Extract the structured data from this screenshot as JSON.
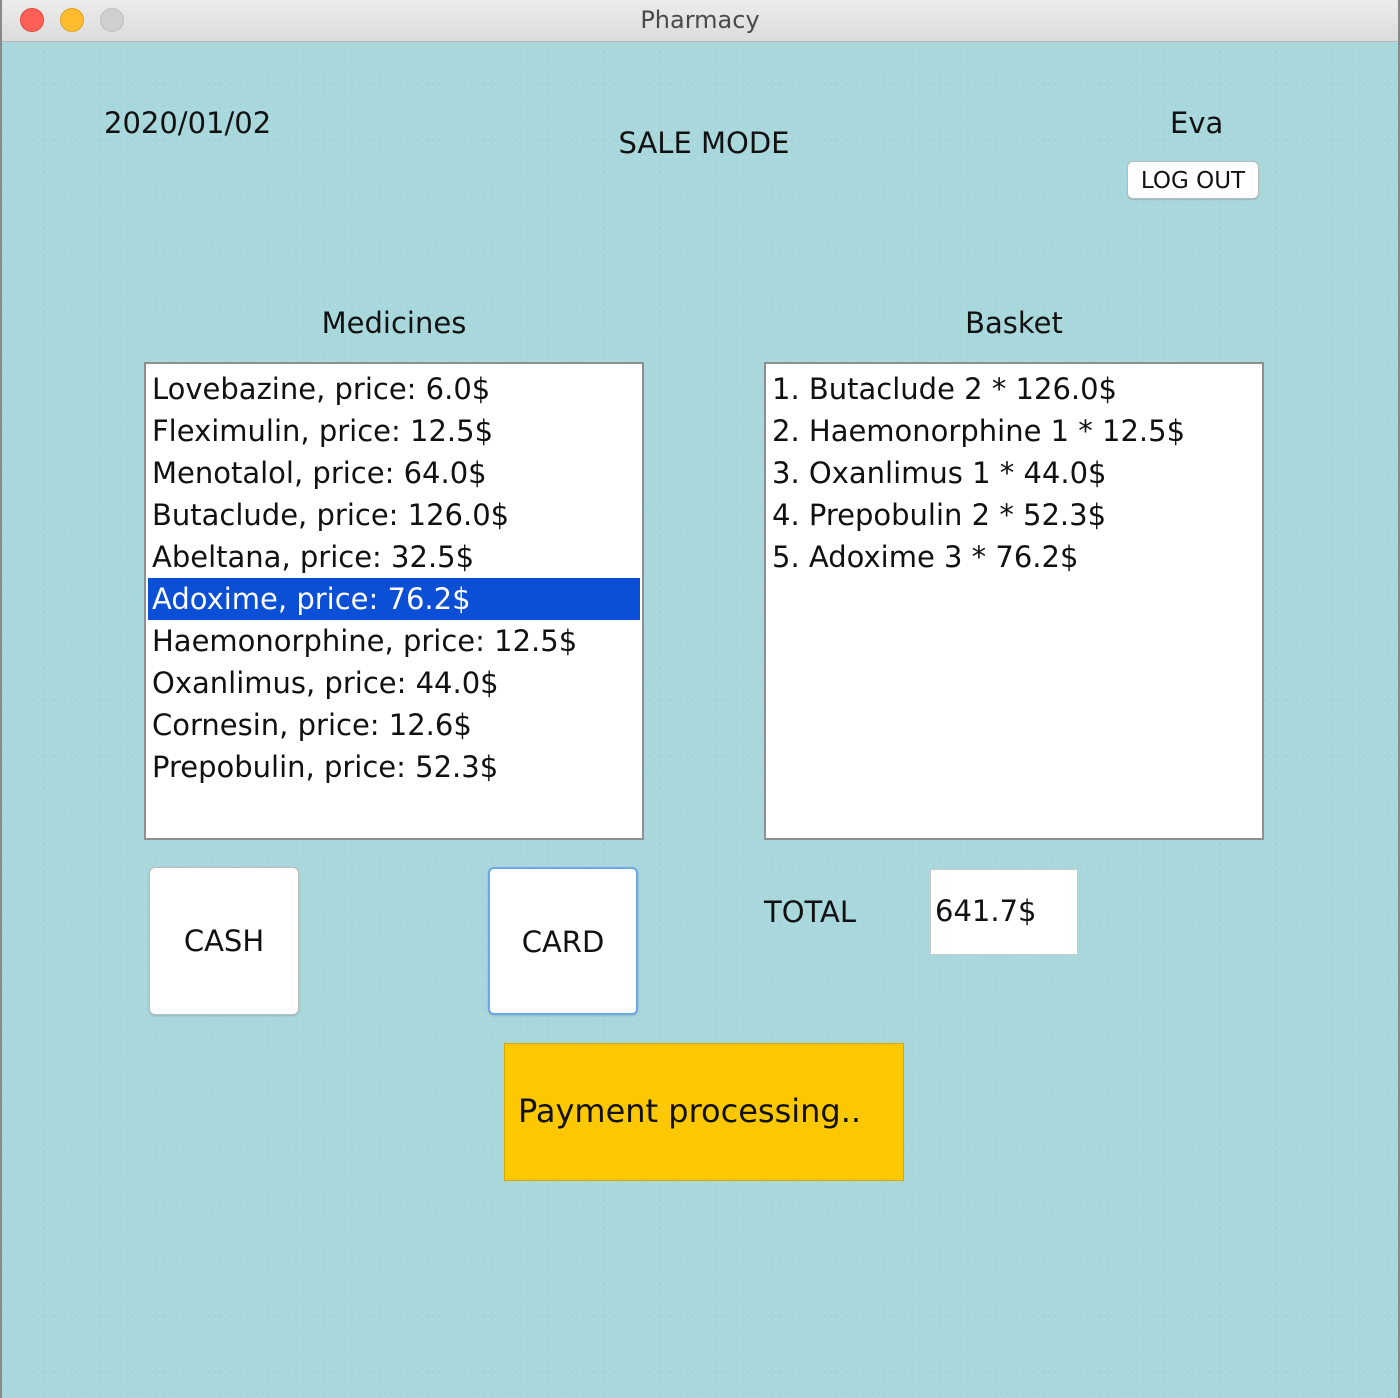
{
  "window": {
    "title": "Pharmacy"
  },
  "header": {
    "date": "2020/01/02",
    "mode": "SALE MODE",
    "user": "Eva",
    "logout_label": "LOG OUT"
  },
  "medicines": {
    "title": "Medicines",
    "items": [
      {
        "label": "Lovebazine, price: 6.0$"
      },
      {
        "label": "Fleximulin, price: 12.5$"
      },
      {
        "label": "Menotalol, price: 64.0$"
      },
      {
        "label": "Butaclude, price: 126.0$"
      },
      {
        "label": "Abeltana, price: 32.5$"
      },
      {
        "label": "Adoxime, price: 76.2$"
      },
      {
        "label": "Haemonorphine, price: 12.5$"
      },
      {
        "label": "Oxanlimus, price: 44.0$"
      },
      {
        "label": "Cornesin, price: 12.6$"
      },
      {
        "label": "Prepobulin, price: 52.3$"
      }
    ],
    "selected_index": 5
  },
  "basket": {
    "title": "Basket",
    "items": [
      {
        "label": "1. Butaclude 2 * 126.0$"
      },
      {
        "label": "2. Haemonorphine 1 * 12.5$"
      },
      {
        "label": "3. Oxanlimus 1 * 44.0$"
      },
      {
        "label": "4. Prepobulin 2 * 52.3$"
      },
      {
        "label": "5. Adoxime 3 * 76.2$"
      }
    ]
  },
  "payment": {
    "cash_label": "CASH",
    "card_label": "CARD",
    "total_label": "TOTAL",
    "total_value": "641.7$",
    "status": "Payment processing.."
  },
  "colors": {
    "background": "#a9d8dc",
    "selection": "#0a4fd6",
    "status_box": "#fec800"
  }
}
